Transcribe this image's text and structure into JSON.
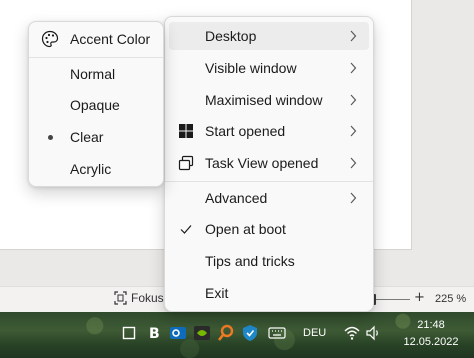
{
  "statusbar": {
    "focus_label": "Fokus",
    "zoom_plus": "+",
    "zoom_value": "225 %"
  },
  "submenu": {
    "header_label": "Accent Color",
    "header_icon": "palette-icon",
    "options": [
      {
        "label": "Normal",
        "selected": false
      },
      {
        "label": "Opaque",
        "selected": false
      },
      {
        "label": "Clear",
        "selected": true
      },
      {
        "label": "Acrylic",
        "selected": false
      }
    ]
  },
  "menu": {
    "items": [
      {
        "label": "Desktop",
        "submenu": true,
        "icon": null,
        "highlighted": true
      },
      {
        "label": "Visible window",
        "submenu": true,
        "icon": null
      },
      {
        "label": "Maximised window",
        "submenu": true,
        "icon": null
      },
      {
        "label": "Task View opened",
        "submenu": true,
        "icon": "task-view-icon"
      },
      {
        "label": "Start opened",
        "submenu": true,
        "icon": "windows-start-icon"
      },
      {
        "label": "Advanced",
        "submenu": true,
        "icon": null
      },
      {
        "label": "Open at boot",
        "submenu": false,
        "icon": "checkmark-icon",
        "checked": true
      },
      {
        "label": "Tips and tricks",
        "submenu": false,
        "icon": null
      },
      {
        "label": "Exit",
        "submenu": false,
        "icon": null
      }
    ]
  },
  "taskbar": {
    "language": "DEU",
    "time": "21:48",
    "date": "12.05.2022"
  },
  "colors": {
    "menu_bg": "#f9f9f9",
    "menu_highlight": "#ececec",
    "text": "#1b1b1b"
  }
}
